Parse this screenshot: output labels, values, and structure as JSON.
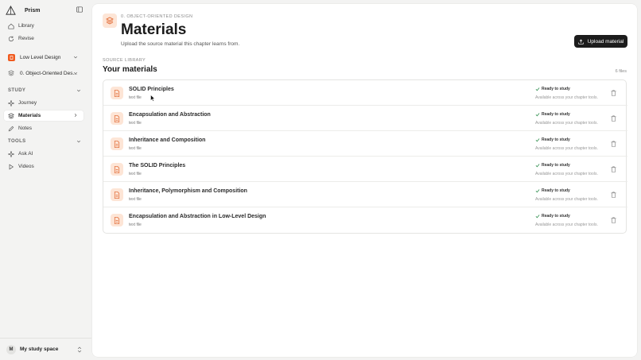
{
  "app": {
    "name": "Prism"
  },
  "sidebar": {
    "nav_top": [
      {
        "label": "Library",
        "icon": "home-icon"
      },
      {
        "label": "Revise",
        "icon": "refresh-icon"
      }
    ],
    "course": {
      "label": "Low Level Design",
      "icon": "book-icon",
      "color": "#f05a1e"
    },
    "chapter": {
      "label": "0. Object-Oriented Des..."
    },
    "study_header": "STUDY",
    "study_items": [
      {
        "label": "Journey",
        "icon": "sparkle-icon"
      },
      {
        "label": "Materials",
        "icon": "layers-icon",
        "active": true
      },
      {
        "label": "Notes",
        "icon": "pencil-icon"
      }
    ],
    "tools_header": "TOOLS",
    "tools_items": [
      {
        "label": "Ask AI",
        "icon": "sparkle-icon"
      },
      {
        "label": "Videos",
        "icon": "play-icon"
      }
    ],
    "workspace": {
      "avatar": "M",
      "label": "My study space"
    }
  },
  "header": {
    "breadcrumb": "0. OBJECT-ORIENTED DESIGN",
    "title": "Materials",
    "subtitle": "Upload the source material this chapter learns from.",
    "upload_label": "Upload material"
  },
  "library": {
    "label": "SOURCE LIBRARY",
    "title": "Your materials",
    "count": "6 files",
    "files": [
      {
        "name": "SOLID Principles",
        "type": "text file",
        "status": "Ready to study",
        "note": "Available across your chapter tools."
      },
      {
        "name": "Encapsulation and Abstraction",
        "type": "text file",
        "status": "Ready to study",
        "note": "Available across your chapter tools."
      },
      {
        "name": "Inheritance and Composition",
        "type": "text file",
        "status": "Ready to study",
        "note": "Available across your chapter tools."
      },
      {
        "name": "The SOLID Principles",
        "type": "text file",
        "status": "Ready to study",
        "note": "Available across your chapter tools."
      },
      {
        "name": "Inheritance, Polymorphism and Composition",
        "type": "text file",
        "status": "Ready to study",
        "note": "Available across your chapter tools."
      },
      {
        "name": "Encapsulation and Abstraction in Low-Level Design",
        "type": "text file",
        "status": "Ready to study",
        "note": "Available across your chapter tools."
      }
    ]
  },
  "colors": {
    "accent": "#f05a1e",
    "accent_soft": "#fde5d6",
    "status_ok": "#2f8f4e"
  }
}
